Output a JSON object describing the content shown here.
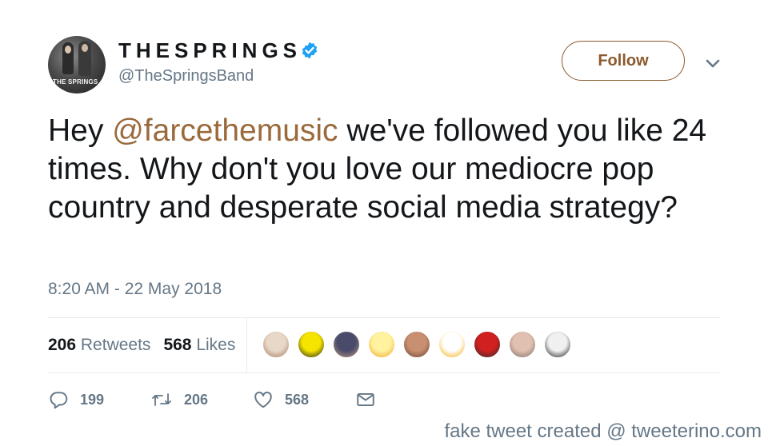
{
  "user": {
    "display_name": "THESPRINGS",
    "handle": "@TheSpringsBand",
    "avatar_text": "THE SPRINGS",
    "verified": true,
    "verified_icon": "verified-badge-icon"
  },
  "follow_label": "Follow",
  "tweet": {
    "pre": "Hey ",
    "mention": "@farcethemusic",
    "post": " we've followed you like 24 times. Why don't you love our mediocre pop country and desperate social media strategy?"
  },
  "timestamp": "8:20 AM - 22 May 2018",
  "stats": {
    "retweets_count": "206",
    "retweets_label": "Retweets",
    "likes_count": "568",
    "likes_label": "Likes"
  },
  "liker_avatars": [
    {
      "colors": [
        "#e8d8c8",
        "#a0765a"
      ]
    },
    {
      "colors": [
        "#f5e400",
        "#1a1a1a"
      ]
    },
    {
      "colors": [
        "#4a4a6a",
        "#c0a080"
      ]
    },
    {
      "colors": [
        "#fff3a0",
        "#f0a020"
      ]
    },
    {
      "colors": [
        "#c89070",
        "#6a4030"
      ]
    },
    {
      "colors": [
        "#ffffff",
        "#f5a800"
      ]
    },
    {
      "colors": [
        "#d02020",
        "#2a2a2a"
      ]
    },
    {
      "colors": [
        "#e0c0b0",
        "#7a6a6a"
      ]
    },
    {
      "colors": [
        "#f0f0f0",
        "#101010"
      ]
    }
  ],
  "actions": {
    "reply_count": "199",
    "retweet_count": "206",
    "like_count": "568"
  },
  "icons": {
    "reply": "reply-icon",
    "retweet": "retweet-icon",
    "like": "heart-icon",
    "dm": "envelope-icon",
    "caret": "chevron-down-icon"
  },
  "colors": {
    "accent": "#8c5a2d",
    "mention": "#9a6a3c",
    "muted": "#657786",
    "verified": "#1da1f2"
  },
  "credit": "fake tweet created @ tweeterino.com"
}
